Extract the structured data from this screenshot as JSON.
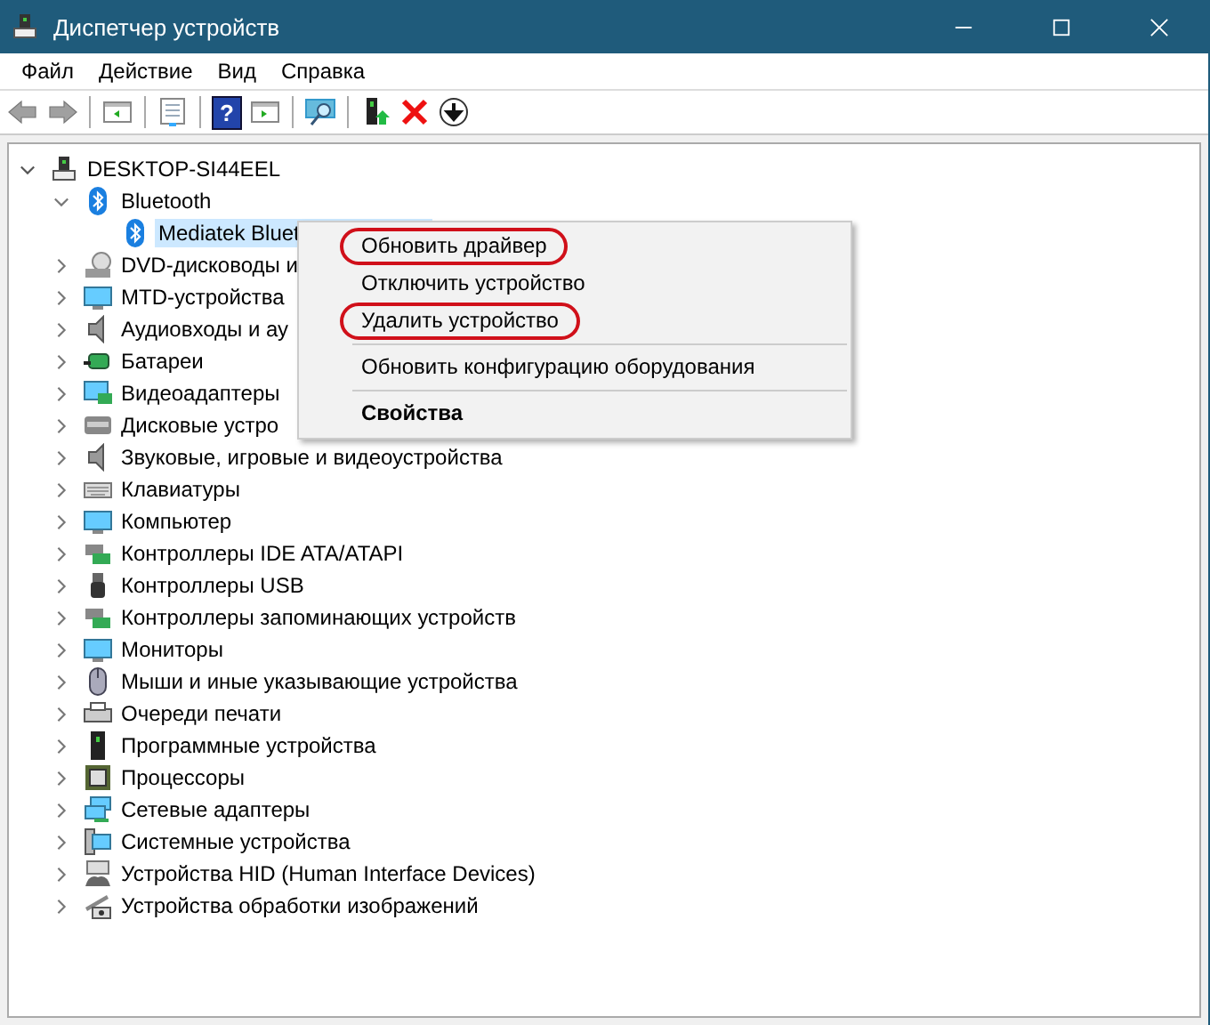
{
  "window": {
    "title": "Диспетчер устройств"
  },
  "menu": [
    "Файл",
    "Действие",
    "Вид",
    "Справка"
  ],
  "toolbar": [
    {
      "kind": "back",
      "disabled": true
    },
    {
      "kind": "forward",
      "disabled": true
    },
    {
      "kind": "sep"
    },
    {
      "kind": "panel"
    },
    {
      "kind": "sep"
    },
    {
      "kind": "doc"
    },
    {
      "kind": "sep"
    },
    {
      "kind": "help",
      "label": "?"
    },
    {
      "kind": "panel2"
    },
    {
      "kind": "sep"
    },
    {
      "kind": "scan"
    },
    {
      "kind": "sep"
    },
    {
      "kind": "update"
    },
    {
      "kind": "remove"
    },
    {
      "kind": "download"
    }
  ],
  "tree": {
    "label": "DESKTOP-SI44EEL",
    "expanded": true,
    "selected": false,
    "children": [
      {
        "label": "Bluetooth",
        "expanded": true,
        "selected": false,
        "children": [
          {
            "label": "Mediatek Bluet",
            "selected": true
          }
        ]
      },
      {
        "label": "DVD-дисководы и",
        "expanded": false,
        "selected": false
      },
      {
        "label": "MTD-устройства",
        "expanded": false,
        "selected": false
      },
      {
        "label": "Аудиовходы и ау",
        "expanded": false,
        "selected": false
      },
      {
        "label": "Батареи",
        "expanded": false,
        "selected": false
      },
      {
        "label": "Видеоадаптеры",
        "expanded": false,
        "selected": false
      },
      {
        "label": "Дисковые устро",
        "expanded": false,
        "selected": false
      },
      {
        "label": "Звуковые, игровые и видеоустройства",
        "expanded": false,
        "selected": false
      },
      {
        "label": "Клавиатуры",
        "expanded": false,
        "selected": false
      },
      {
        "label": "Компьютер",
        "expanded": false,
        "selected": false
      },
      {
        "label": "Контроллеры IDE ATA/ATAPI",
        "expanded": false,
        "selected": false
      },
      {
        "label": "Контроллеры USB",
        "expanded": false,
        "selected": false
      },
      {
        "label": "Контроллеры запоминающих устройств",
        "expanded": false,
        "selected": false
      },
      {
        "label": "Мониторы",
        "expanded": false,
        "selected": false
      },
      {
        "label": "Мыши и иные указывающие устройства",
        "expanded": false,
        "selected": false
      },
      {
        "label": "Очереди печати",
        "expanded": false,
        "selected": false
      },
      {
        "label": "Программные устройства",
        "expanded": false,
        "selected": false
      },
      {
        "label": "Процессоры",
        "expanded": false,
        "selected": false
      },
      {
        "label": "Сетевые адаптеры",
        "expanded": false,
        "selected": false
      },
      {
        "label": "Системные устройства",
        "expanded": false,
        "selected": false
      },
      {
        "label": "Устройства HID (Human Interface Devices)",
        "expanded": false,
        "selected": false
      },
      {
        "label": "Устройства обработки изображений",
        "expanded": false,
        "selected": false
      }
    ]
  },
  "context_menu": [
    {
      "kind": "item",
      "label": "Обновить драйвер",
      "bold": false,
      "circled": true
    },
    {
      "kind": "item",
      "label": "Отключить устройство",
      "bold": false,
      "circled": false
    },
    {
      "kind": "item",
      "label": "Удалить устройство",
      "bold": false,
      "circled": true
    },
    {
      "kind": "separator"
    },
    {
      "kind": "item",
      "label": "Обновить конфигурацию оборудования",
      "bold": false,
      "circled": false
    },
    {
      "kind": "separator"
    },
    {
      "kind": "item",
      "label": "Свойства",
      "bold": true,
      "circled": false
    }
  ]
}
